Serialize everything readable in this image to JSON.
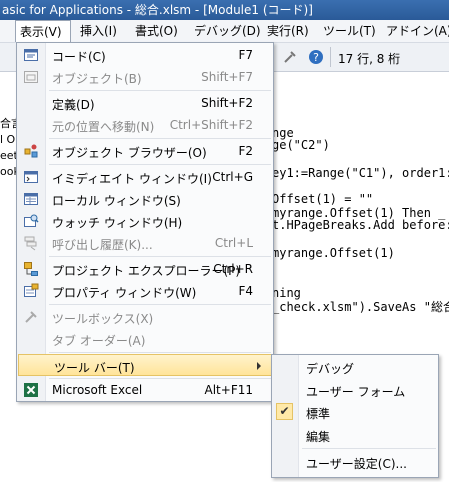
{
  "window": {
    "title": "asic for Applications - 総合.xlsm - [Module1 (コード)]"
  },
  "menubar": {
    "items": [
      {
        "label": "表示(V)"
      },
      {
        "label": "挿入(I)"
      },
      {
        "label": "書式(O)"
      },
      {
        "label": "デバッグ(D)"
      },
      {
        "label": "実行(R)"
      },
      {
        "label": "ツール(T)"
      },
      {
        "label": "アドイン(A)"
      }
    ]
  },
  "toolbar": {
    "position": "17 行, 8 桁"
  },
  "project_pane": {
    "lines": [
      "合言",
      "l O",
      "eet",
      "ook"
    ]
  },
  "code": {
    "lines": [
      "nge",
      "ge(\"C2\")",
      "ey1:=Range(\"C1\"), order1:",
      "Offset(1) = \"\"",
      "myrange.Offset(1) Then _",
      "t.HPageBreaks.Add before:",
      "myrange.Offset(1)",
      "ning",
      "_check.xlsm\").SaveAs \"総合"
    ]
  },
  "view_menu": {
    "items": [
      {
        "label": "コード(C)",
        "shortcut": "F7",
        "icon": "code-window-icon",
        "disabled": false
      },
      {
        "label": "オブジェクト(B)",
        "shortcut": "Shift+F7",
        "icon": "object-window-icon",
        "disabled": true
      },
      {
        "label": "定義(D)",
        "shortcut": "Shift+F2",
        "icon": "",
        "disabled": false
      },
      {
        "label": "元の位置へ移動(N)",
        "shortcut": "Ctrl+Shift+F2",
        "icon": "",
        "disabled": true
      },
      {
        "label": "オブジェクト ブラウザー(O)",
        "shortcut": "F2",
        "icon": "object-browser-icon",
        "disabled": false
      },
      {
        "label": "イミディエイト ウィンドウ(I)",
        "shortcut": "Ctrl+G",
        "icon": "immediate-window-icon",
        "disabled": false
      },
      {
        "label": "ローカル ウィンドウ(S)",
        "shortcut": "",
        "icon": "locals-window-icon",
        "disabled": false
      },
      {
        "label": "ウォッチ ウィンドウ(H)",
        "shortcut": "",
        "icon": "watch-window-icon",
        "disabled": false
      },
      {
        "label": "呼び出し履歴(K)...",
        "shortcut": "Ctrl+L",
        "icon": "call-stack-icon",
        "disabled": true
      },
      {
        "label": "プロジェクト エクスプローラー(P)",
        "shortcut": "Ctrl+R",
        "icon": "project-explorer-icon",
        "disabled": false
      },
      {
        "label": "プロパティ ウィンドウ(W)",
        "shortcut": "F4",
        "icon": "properties-window-icon",
        "disabled": false
      },
      {
        "label": "ツールボックス(X)",
        "shortcut": "",
        "icon": "toolbox-icon",
        "disabled": true
      },
      {
        "label": "タブ オーダー(A)",
        "shortcut": "",
        "icon": "",
        "disabled": true
      },
      {
        "label": "ツール バー(T)",
        "shortcut": "",
        "icon": "",
        "disabled": false
      },
      {
        "label": "Microsoft Excel",
        "shortcut": "Alt+F11",
        "icon": "excel-icon",
        "disabled": false
      }
    ]
  },
  "toolbar_submenu": {
    "items": [
      {
        "label": "デバッグ",
        "checked": false
      },
      {
        "label": "ユーザー フォーム",
        "checked": false
      },
      {
        "label": "標準",
        "checked": true
      },
      {
        "label": "編集",
        "checked": false
      },
      {
        "label": "ユーザー設定(C)...",
        "checked": false
      }
    ]
  },
  "colors": {
    "highlight": "#ffe49a",
    "titlebar": "#2a5a98"
  }
}
